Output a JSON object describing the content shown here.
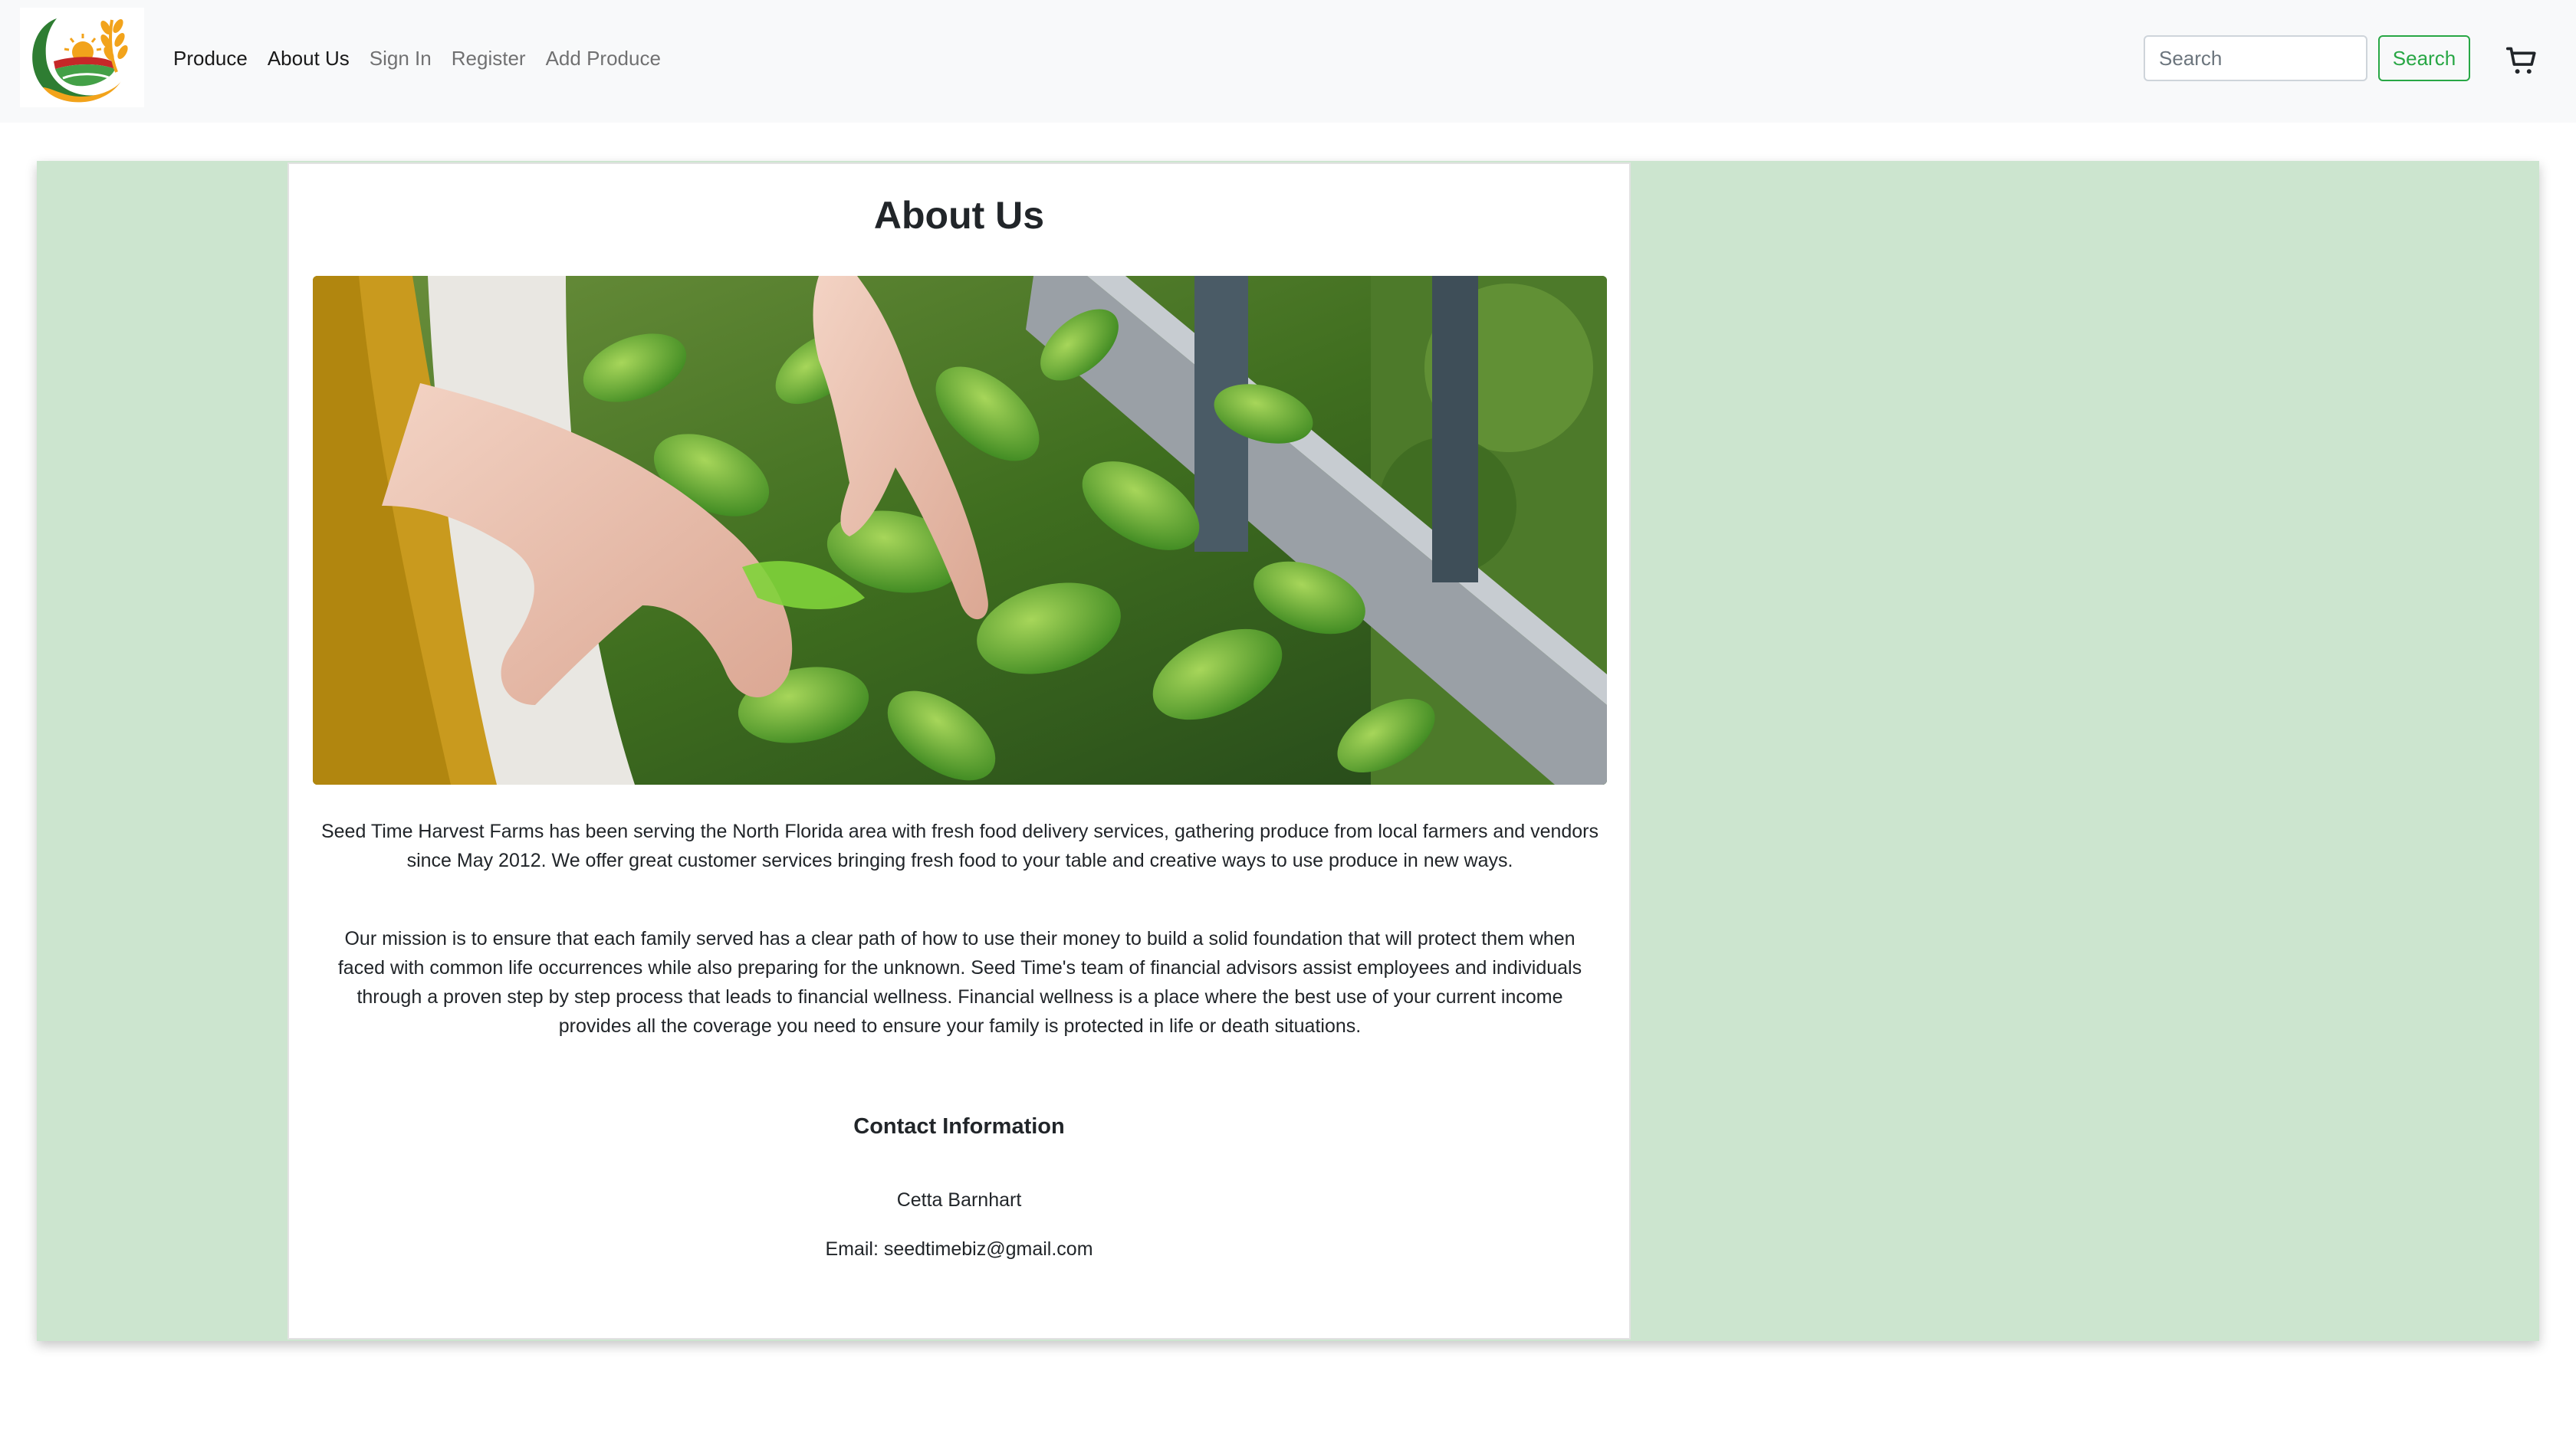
{
  "nav": {
    "links": [
      {
        "label": "Produce",
        "active": true
      },
      {
        "label": "About Us",
        "active": true
      },
      {
        "label": "Sign In",
        "active": false
      },
      {
        "label": "Register",
        "active": false
      },
      {
        "label": "Add Produce",
        "active": false
      }
    ],
    "search_placeholder": "Search",
    "search_button": "Search",
    "cart_icon": "cart-icon",
    "logo_icon": "farm-logo"
  },
  "colors": {
    "panel_bg": "#cce5cf",
    "accent_green": "#28a745",
    "navbar_bg": "#f8f9fa"
  },
  "page": {
    "title": "About Us",
    "hero_image": "hands-picking-basil-photo",
    "paragraphs": [
      "Seed Time Harvest Farms has been serving the North Florida area with fresh food delivery services, gathering produce from local farmers and vendors since May 2012. We offer great customer services bringing fresh food to your table and creative ways to use produce in new ways.",
      "Our mission is to ensure that each family served has a clear path of how to use their money to build a solid foundation that will protect them when faced with common life occurrences while also preparing for the unknown. Seed Time's team of financial advisors assist employees and individuals through a proven step by step process that leads to financial wellness. Financial wellness is a place where the best use of your current income provides all the coverage you need to ensure your family is protected in life or death situations."
    ],
    "contact": {
      "heading": "Contact Information",
      "name": "Cetta Barnhart",
      "email": "Email: seedtimebiz@gmail.com"
    }
  }
}
